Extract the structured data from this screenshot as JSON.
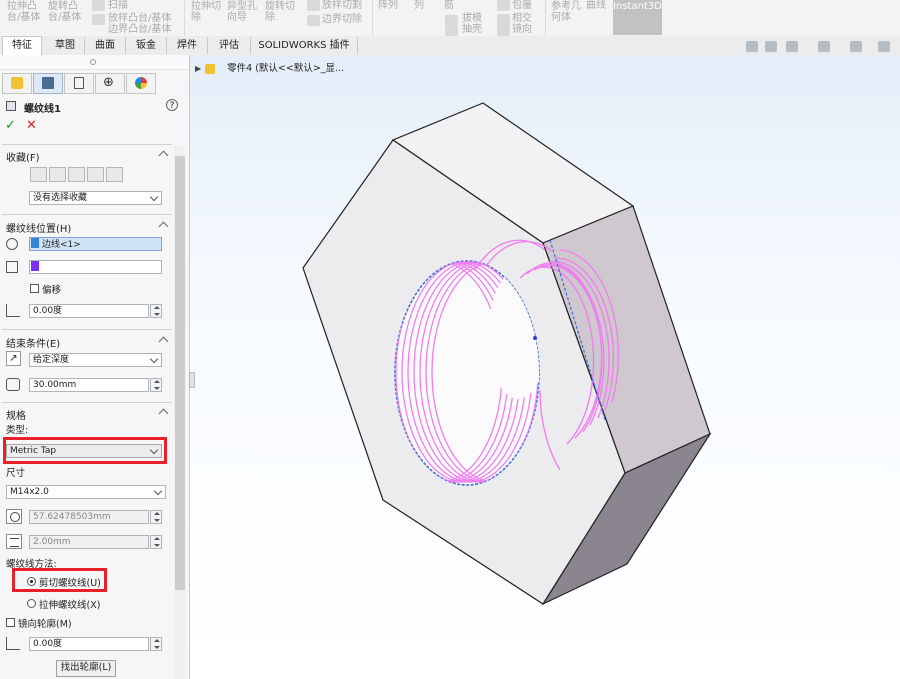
{
  "ribbon": {
    "items": [
      "拉伸凸",
      "台/基体",
      "旋转凸",
      "台/基体",
      "扫描",
      "放样凸台/基体",
      "边界凸台/基体",
      "拉伸切",
      "除",
      "异型孔",
      "向导",
      "旋转切",
      "除",
      "放样切割",
      "边界切除",
      "阵列",
      "列",
      "筋",
      "拔模",
      "抽壳",
      "包覆",
      "相交",
      "镜向",
      "参考几",
      "何体",
      "曲线"
    ],
    "instant3d": "Instant3D"
  },
  "tabs": [
    "特征",
    "草图",
    "曲面",
    "钣金",
    "焊件",
    "评估",
    "SOLIDWORKS 插件"
  ],
  "active_tab": "特征",
  "tree": {
    "label": "零件4  (默认<<默认>_显..."
  },
  "pm": {
    "title": "螺纹线1",
    "help": "?",
    "ok": "✓",
    "cancel": "✕",
    "favorites": {
      "title": "收藏(F)",
      "dropdown": "没有选择收藏"
    },
    "position": {
      "title": "螺纹线位置(H)",
      "edge": "边线<1>",
      "offset_label": "偏移",
      "angle": "0.00度"
    },
    "end": {
      "title": "结束条件(E)",
      "type": "给定深度",
      "depth": "30.00mm"
    },
    "spec": {
      "title": "规格",
      "type_label": "类型:",
      "type_value": "Metric Tap",
      "size_label": "尺寸",
      "size_value": "M14x2.0",
      "diameter": "57.62478503mm",
      "pitch": "2.00mm"
    },
    "method": {
      "title": "螺纹线方法:",
      "cut": "剪切螺纹线(U)",
      "extrude": "拉伸螺纹线(X)",
      "selected": "cut"
    },
    "mirror_label": "镜向轮廓(M)",
    "angle2": "0.00度",
    "find_button": "找出轮廓(L)"
  },
  "colors": {
    "highlight": "#e8202a",
    "thread": "#f07cf0",
    "edge": "#3a6fd8",
    "accent": "#7b2ff7"
  }
}
